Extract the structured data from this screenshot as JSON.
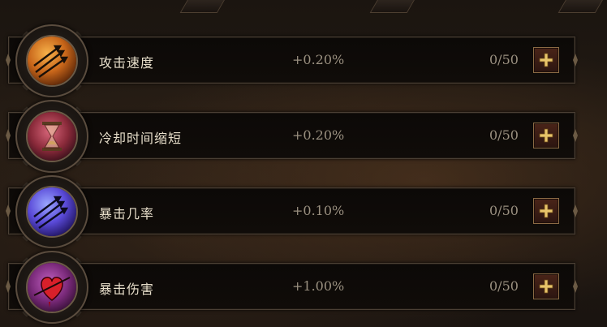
{
  "skills": [
    {
      "name": "攻击速度",
      "bonus": "+0.20%",
      "count": "0/50",
      "icon": "arrows-icon",
      "orb_color": "#c8661a",
      "orb_dark": "#5a2608"
    },
    {
      "name": "冷却时间缩短",
      "bonus": "+0.20%",
      "count": "0/50",
      "icon": "hourglass-icon",
      "orb_color": "#8a2a3a",
      "orb_dark": "#2a0a14"
    },
    {
      "name": "暴击几率",
      "bonus": "+0.10%",
      "count": "0/50",
      "icon": "arrows-icon",
      "orb_color": "#5a4ad8",
      "orb_dark": "#201460"
    },
    {
      "name": "暴击伤害",
      "bonus": "+1.00%",
      "count": "0/50",
      "icon": "bleeding-heart-icon",
      "orb_color": "#7a2a7a",
      "orb_dark": "#2a0a2a"
    }
  ]
}
